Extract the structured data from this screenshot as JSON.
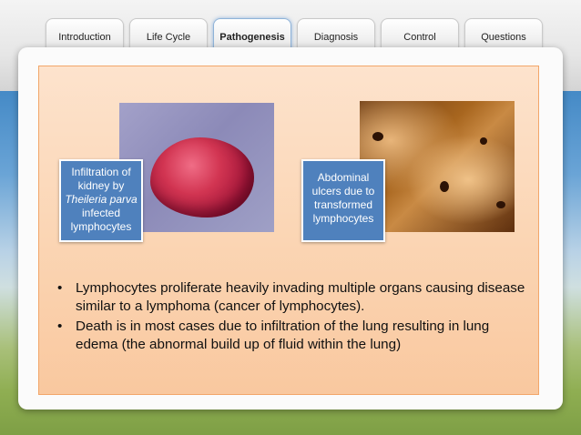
{
  "nav": {
    "tabs": [
      {
        "label": "Introduction"
      },
      {
        "label": "Life Cycle"
      },
      {
        "label": "Pathogenesis",
        "active": true
      },
      {
        "label": "Diagnosis"
      },
      {
        "label": "Control"
      },
      {
        "label": "Questions"
      }
    ]
  },
  "slide": {
    "caption_kidney": {
      "line1": "Infiltration of kidney by",
      "italic": "Theileria parva",
      "line2": "infected lymphocytes"
    },
    "caption_abdomen": "Abdominal ulcers due to transformed lymphocytes",
    "bullets": [
      "Lymphocytes proliferate heavily invading multiple organs causing disease similar to a lymphoma (cancer of lymphocytes).",
      "Death is in most cases due to infiltration of the lung resulting in lung edema (the abnormal build up of fluid within the lung)"
    ]
  },
  "colors": {
    "caption_bg": "#4f81bd",
    "content_border": "#f2a66a",
    "content_fill": "#fbd6b5"
  }
}
